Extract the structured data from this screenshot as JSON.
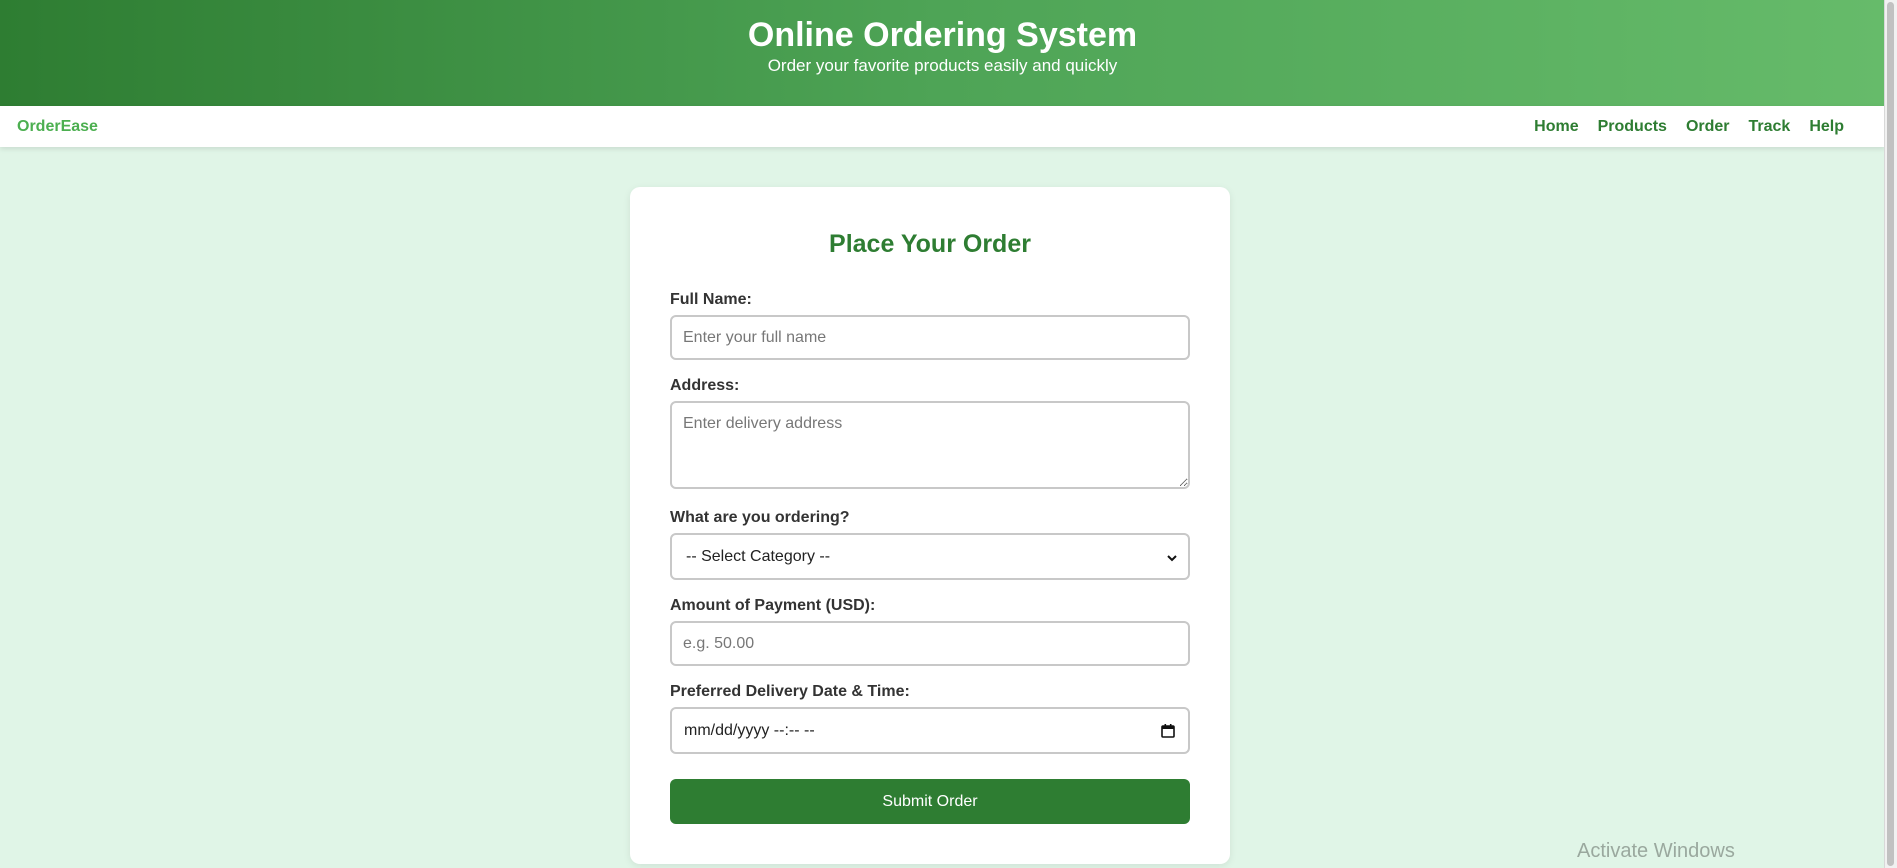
{
  "header": {
    "title": "Online Ordering System",
    "subtitle": "Order your favorite products easily and quickly"
  },
  "navbar": {
    "brand": "OrderEase",
    "links": [
      "Home",
      "Products",
      "Order",
      "Track",
      "Help"
    ]
  },
  "form": {
    "title": "Place Your Order",
    "full_name": {
      "label": "Full Name:",
      "placeholder": "Enter your full name",
      "value": ""
    },
    "address": {
      "label": "Address:",
      "placeholder": "Enter delivery address",
      "value": ""
    },
    "category": {
      "label": "What are you ordering?",
      "selected": "-- Select Category --",
      "icon": "chevron-down-icon"
    },
    "amount": {
      "label": "Amount of Payment (USD):",
      "placeholder": "e.g. 50.00",
      "value": ""
    },
    "delivery": {
      "label": "Preferred Delivery Date & Time:",
      "display": "mm/dd/yyyy --:-- --",
      "icon": "calendar-icon"
    },
    "submit_label": "Submit Order"
  },
  "watermark": "Activate Windows",
  "colors": {
    "header_gradient_start": "#2e7d32",
    "header_gradient_end": "#66bb6a",
    "primary": "#2e7d32",
    "brand": "#4caf50",
    "page_background": "#e0f5e7"
  }
}
